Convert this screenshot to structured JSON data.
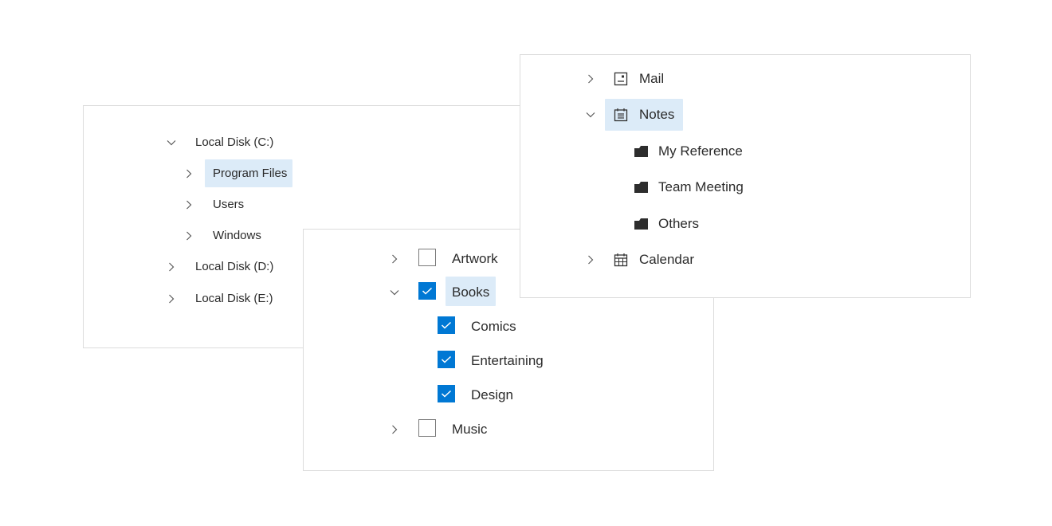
{
  "file_tree": {
    "items": [
      {
        "label": "Local Disk (C:)",
        "state": "expanded"
      },
      {
        "label": "Program Files",
        "state": "collapsed",
        "selected": true
      },
      {
        "label": "Users",
        "state": "collapsed"
      },
      {
        "label": "Windows",
        "state": "collapsed"
      },
      {
        "label": "Local Disk (D:)",
        "state": "collapsed"
      },
      {
        "label": "Local Disk (E:)",
        "state": "collapsed"
      }
    ]
  },
  "check_tree": {
    "items": [
      {
        "label": "Artwork",
        "checked": false,
        "state": "collapsed"
      },
      {
        "label": "Books",
        "checked": true,
        "state": "expanded",
        "selected": true
      },
      {
        "label": "Comics",
        "checked": true
      },
      {
        "label": "Entertaining",
        "checked": true
      },
      {
        "label": "Design",
        "checked": true
      },
      {
        "label": "Music",
        "checked": false,
        "state": "collapsed"
      }
    ]
  },
  "mail_tree": {
    "items": [
      {
        "label": "Mail",
        "icon": "mail-icon",
        "state": "collapsed"
      },
      {
        "label": "Notes",
        "icon": "notes-icon",
        "state": "expanded",
        "selected": true
      },
      {
        "label": "My Reference",
        "icon": "folder-icon"
      },
      {
        "label": "Team Meeting",
        "icon": "folder-icon"
      },
      {
        "label": "Others",
        "icon": "folder-icon"
      },
      {
        "label": "Calendar",
        "icon": "calendar-icon",
        "state": "collapsed"
      }
    ]
  },
  "colors": {
    "accent": "#0078d4",
    "selection": "#dcebf8",
    "border": "#dcdcdc"
  }
}
